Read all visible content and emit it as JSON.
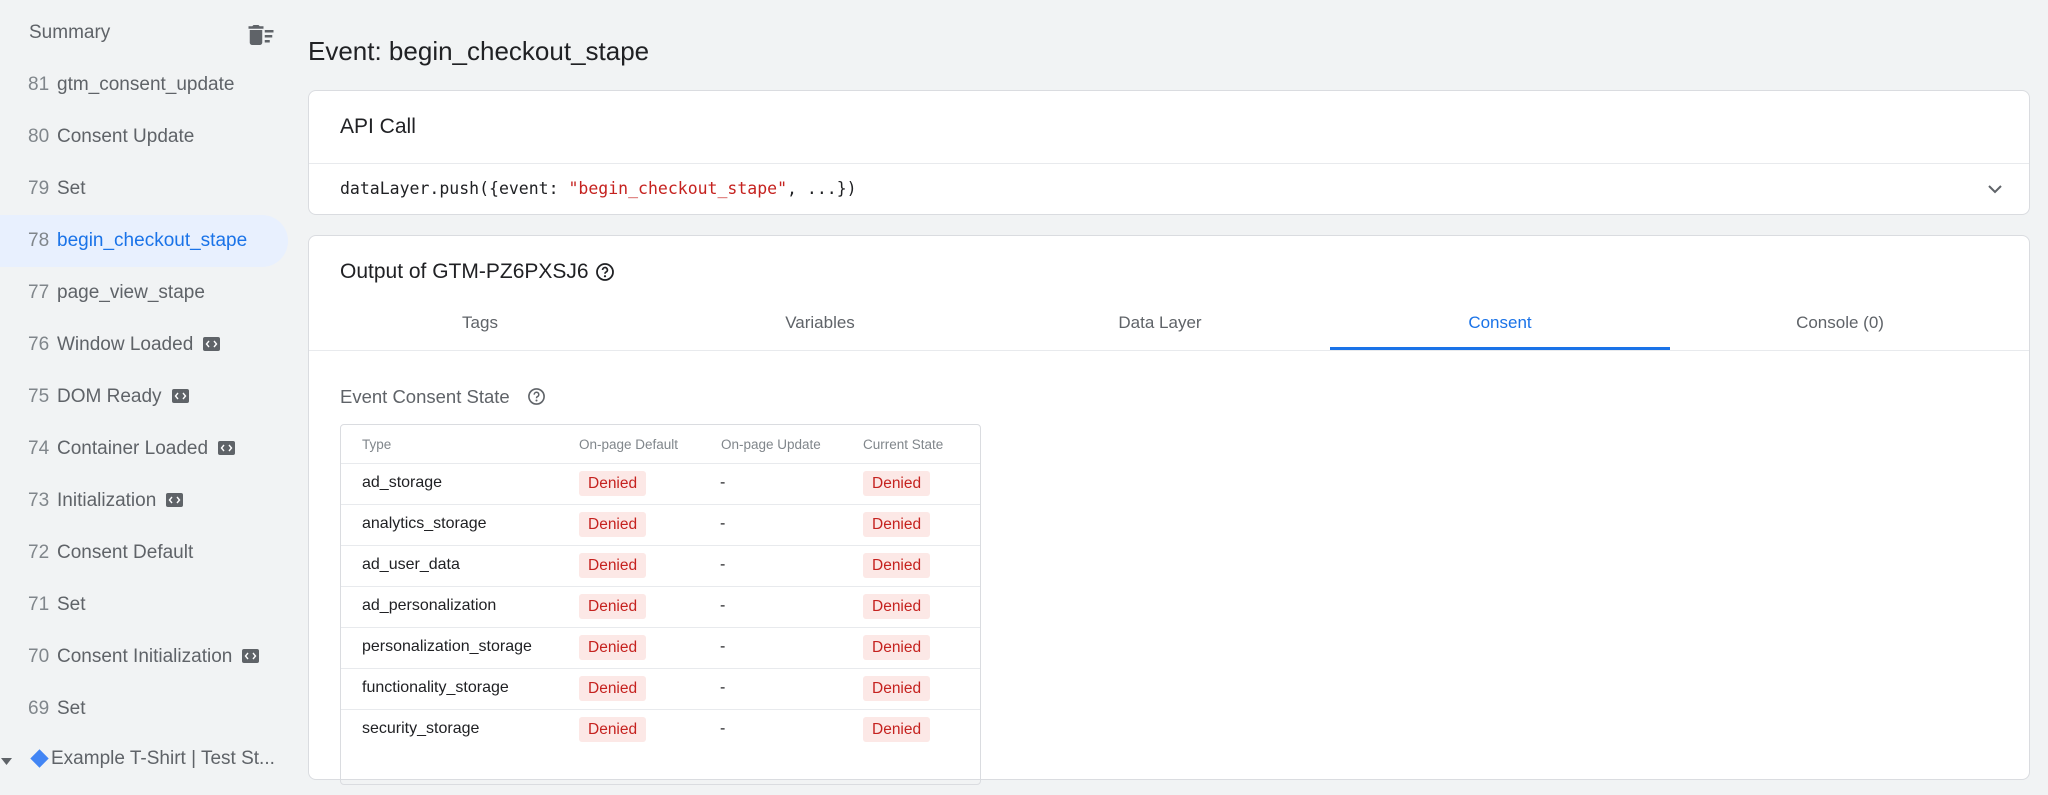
{
  "sidebar": {
    "summary_label": "Summary",
    "events": [
      {
        "num": "81",
        "name": "gtm_consent_update",
        "badge": false,
        "active": false
      },
      {
        "num": "80",
        "name": "Consent Update",
        "badge": false,
        "active": false
      },
      {
        "num": "79",
        "name": "Set",
        "badge": false,
        "active": false
      },
      {
        "num": "78",
        "name": "begin_checkout_stape",
        "badge": false,
        "active": true
      },
      {
        "num": "77",
        "name": "page_view_stape",
        "badge": false,
        "active": false
      },
      {
        "num": "76",
        "name": "Window Loaded",
        "badge": true,
        "active": false
      },
      {
        "num": "75",
        "name": "DOM Ready",
        "badge": true,
        "active": false
      },
      {
        "num": "74",
        "name": "Container Loaded",
        "badge": true,
        "active": false
      },
      {
        "num": "73",
        "name": "Initialization",
        "badge": true,
        "active": false
      },
      {
        "num": "72",
        "name": "Consent Default",
        "badge": false,
        "active": false
      },
      {
        "num": "71",
        "name": "Set",
        "badge": false,
        "active": false
      },
      {
        "num": "70",
        "name": "Consent Initialization",
        "badge": true,
        "active": false
      },
      {
        "num": "69",
        "name": "Set",
        "badge": false,
        "active": false
      }
    ],
    "page_item_label": "Example T-Shirt | Test St..."
  },
  "main": {
    "event_title": "Event: begin_checkout_stape",
    "api_call": {
      "title": "API Call",
      "code_prefix": "dataLayer.push({event: ",
      "code_string": "\"begin_checkout_stape\"",
      "code_suffix": ", ...})"
    },
    "output": {
      "title": "Output of GTM-PZ6PXSJ6",
      "tabs": [
        {
          "label": "Tags",
          "active": false
        },
        {
          "label": "Variables",
          "active": false
        },
        {
          "label": "Data Layer",
          "active": false
        },
        {
          "label": "Consent",
          "active": true
        },
        {
          "label": "Console (0)",
          "active": false
        }
      ],
      "consent_heading": "Event Consent State",
      "table": {
        "headers": [
          "Type",
          "On-page Default",
          "On-page Update",
          "Current State"
        ],
        "rows": [
          {
            "type": "ad_storage",
            "default": "Denied",
            "update": "-",
            "current": "Denied"
          },
          {
            "type": "analytics_storage",
            "default": "Denied",
            "update": "-",
            "current": "Denied"
          },
          {
            "type": "ad_user_data",
            "default": "Denied",
            "update": "-",
            "current": "Denied"
          },
          {
            "type": "ad_personalization",
            "default": "Denied",
            "update": "-",
            "current": "Denied"
          },
          {
            "type": "personalization_storage",
            "default": "Denied",
            "update": "-",
            "current": "Denied"
          },
          {
            "type": "functionality_storage",
            "default": "Denied",
            "update": "-",
            "current": "Denied"
          },
          {
            "type": "security_storage",
            "default": "Denied",
            "update": "-",
            "current": "Denied"
          }
        ]
      }
    }
  },
  "colors": {
    "accent": "#1a73e8",
    "denied_bg": "#fce8e6",
    "denied_text": "#c5221f",
    "active_item_bg": "#e8f0fe"
  }
}
